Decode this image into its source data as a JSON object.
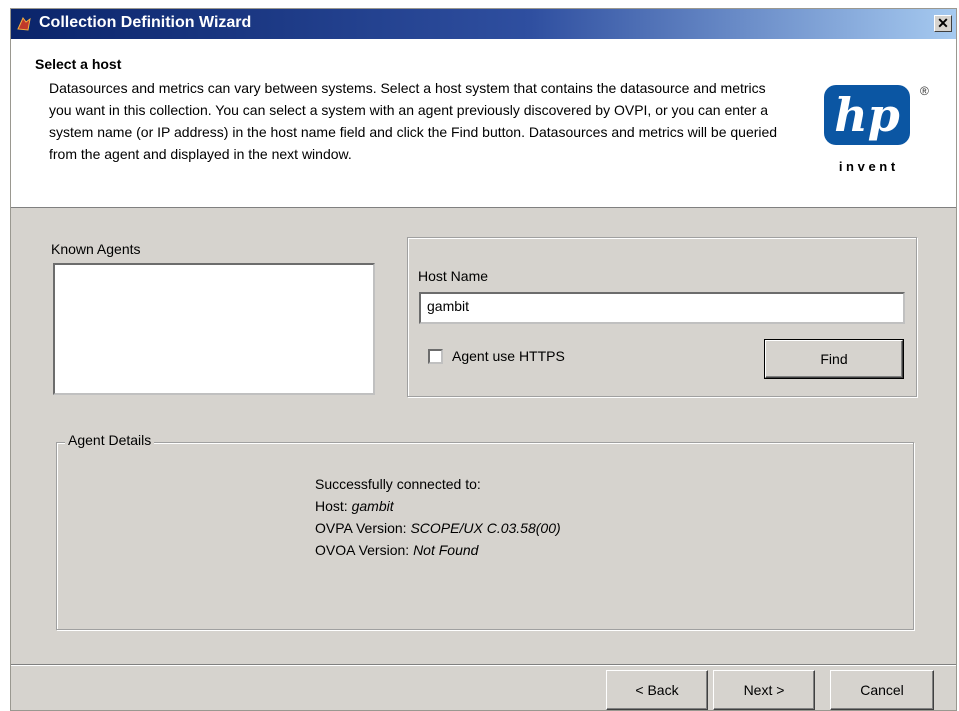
{
  "window": {
    "title": "Collection Definition Wizard",
    "close_glyph": "✕"
  },
  "header": {
    "title": "Select a host",
    "description": "Datasources and metrics can vary between systems. Select a host system that contains the datasource and metrics you want in this collection. You can select a system with an agent previously discovered by OVPI, or you can enter a system name (or IP address) in the host name field and click the Find button. Datasources and metrics will be queried from the agent and displayed in the next window.",
    "logo": {
      "text": "hp",
      "tagline": "i n v e n t",
      "registered": "®",
      "color": "#0b56a3"
    }
  },
  "known_agents": {
    "label": "Known Agents",
    "items": []
  },
  "host": {
    "label": "Host Name",
    "value": "gambit",
    "https_label": "Agent use HTTPS",
    "https_checked": false,
    "find_label": "Find"
  },
  "agent_details": {
    "label": "Agent Details",
    "status": "Successfully connected to:",
    "host_label": "Host:",
    "host_value": "gambit",
    "ovpa_label": "OVPA Version:",
    "ovpa_value": "SCOPE/UX C.03.58(00)",
    "ovoa_label": "OVOA Version:",
    "ovoa_value": "Not Found"
  },
  "footer": {
    "back_label": "< Back",
    "next_label": "Next >",
    "cancel_label": "Cancel"
  }
}
